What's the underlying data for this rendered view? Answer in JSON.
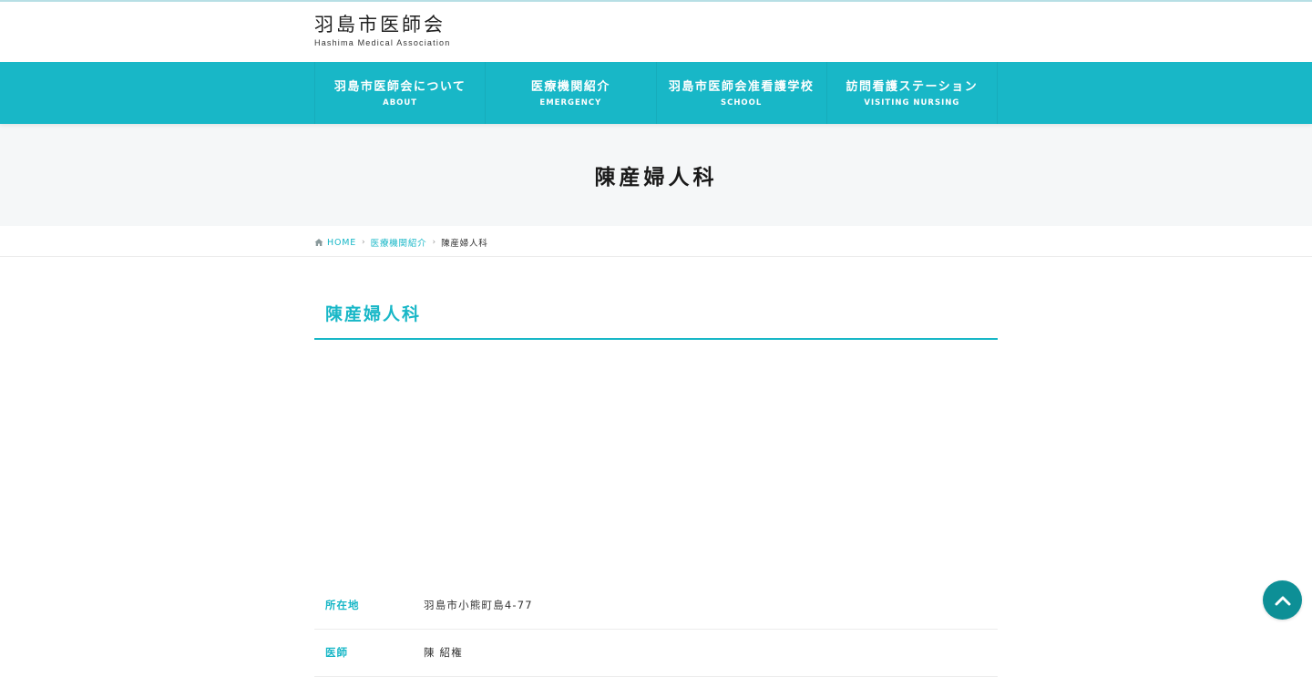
{
  "header": {
    "logo_jp": "羽島市医師会",
    "logo_en": "Hashima Medical Association"
  },
  "nav": {
    "items": [
      {
        "label": "羽島市医師会について",
        "sub": "ABOUT"
      },
      {
        "label": "医療機関紹介",
        "sub": "EMERGENCY"
      },
      {
        "label": "羽島市医師会准看護学校",
        "sub": "SCHOOL"
      },
      {
        "label": "訪問看護ステーション",
        "sub": "VISITING NURSING"
      }
    ]
  },
  "hero": {
    "title": "陳産婦人科"
  },
  "breadcrumb": {
    "home": "HOME",
    "parent": "医療機関紹介",
    "current": "陳産婦人科"
  },
  "content": {
    "title": "陳産婦人科",
    "rows": [
      {
        "label": "所在地",
        "value": "羽島市小熊町島4-77"
      },
      {
        "label": "医師",
        "value": "陳 紹権"
      }
    ]
  },
  "colors": {
    "accent": "#18b7c7",
    "to_top": "#0d8f96",
    "hero_bg": "#f5f7f8"
  },
  "icons": {
    "home": "home-icon",
    "to_top": "chevron-up-icon"
  }
}
